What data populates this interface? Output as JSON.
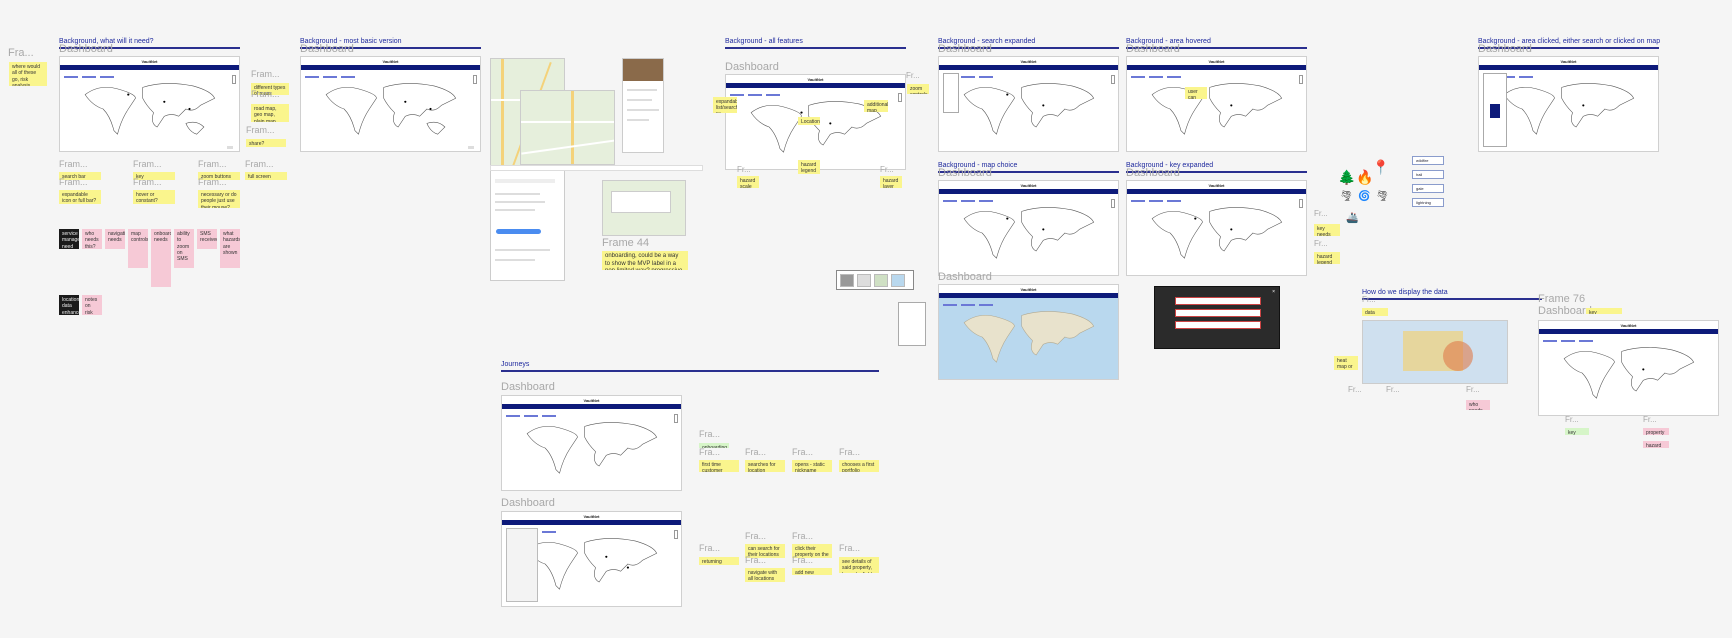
{
  "canvas": {
    "background": "#f5f5f5",
    "accent": "#0d1a7a"
  },
  "section_titles": {
    "bg_need": "Background, what will it need?",
    "bg_basic": "Background - most basic version",
    "bg_all": "Background - all features",
    "bg_search": "Background - search expanded",
    "bg_area_hover": "Background - area hovered",
    "bg_area_click": "Background - area clicked, either search or clicked on map",
    "bg_map_choice": "Background - map choice",
    "bg_key": "Background - key expanded",
    "journeys": "Journeys",
    "display_data": "How do we display the data"
  },
  "frame_labels": {
    "dashboard": "Dashboard",
    "fra": "Fra...",
    "fram": "Fram...",
    "fr": "Fr...",
    "frame44": "Frame 44",
    "frame76": "Frame 76"
  },
  "mockup": {
    "logo": "VaultNet"
  },
  "stickies": {
    "who_would": "where would all of these go, risk analysis, service manager, location data enhancer",
    "diff_maps": "different types of maps",
    "road_map": "road map, geo map, plain map, google map",
    "share": "share?",
    "search_bar": "search bar",
    "expandable": "expandable icon or full bar?",
    "key": "key",
    "hover": "hover or constant?",
    "zoom_buttons": "zoom buttons",
    "necessary": "necessary or do people just use their mouse?",
    "full_screen": "full screen mode",
    "onboarding": "onboarding, could be a way to show the MVP label in a non limited way? progressive onboarding",
    "first_time": "first time customer",
    "searches_location": "searches for location",
    "opens_static": "opens - static nickname",
    "chooses_first": "chooses a first portfolio",
    "onboarding_field": "onboarding field?",
    "returning": "returning customer",
    "can_search": "can search for their locations or click list items",
    "click_property": "click their property on the map",
    "add_new": "add new",
    "navigate_all": "navigate with all locations previously saved",
    "see_details": "see details of said property, hazards, fields etc",
    "all_features_a": "expandable list/search filters, hazard selections",
    "all_features_b": "Location search field",
    "all_features_c": "additional map type selector, toggle for map type",
    "all_features_d": "hazard legend key shows",
    "zoom_note": "zoom controls",
    "area_hover_note": "user can see area snapshot, risk scores",
    "fr_note1": "hazard scale colors",
    "fr_note2": "hazard layer toggles and key",
    "display_note": "data overlay style",
    "display_left": "heat map or pin clusters",
    "frame76_note": "key",
    "frame76_pink1": "property detail",
    "frame76_pink2": "hazard zones"
  },
  "black_stickies": {
    "b1": "service managers need to know risk",
    "b2": "location data enhancer needs more"
  },
  "pink_stickies": {
    "p1": "who needs this?",
    "p2": "navigation needs",
    "p3": "map controls",
    "p4": "onboarding needs",
    "p5": "SMS received",
    "p6": "ability to zoom on SMS",
    "p7": "what hazards are shown",
    "p8": "notes on risk",
    "p9": "key needs"
  },
  "legend_items": [
    "wildfire",
    "hail",
    "gale",
    "lightning"
  ],
  "icon_names": [
    "fire-icon",
    "wind-icon",
    "location-pin-icon",
    "tornado-icon",
    "flood-icon"
  ]
}
